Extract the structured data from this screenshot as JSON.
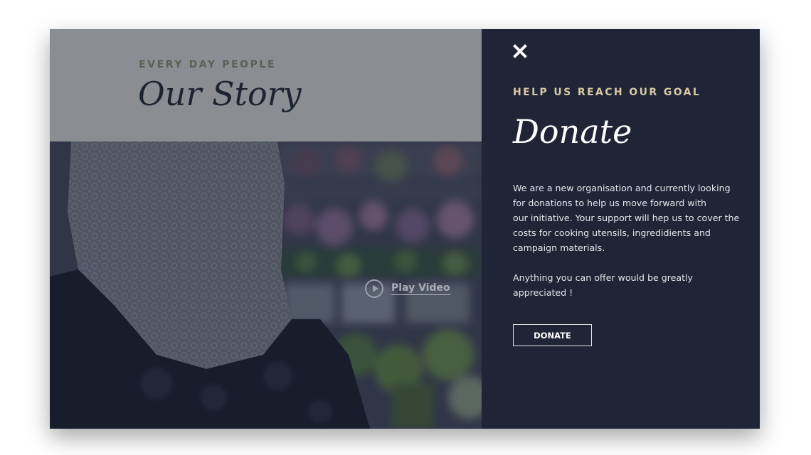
{
  "story": {
    "eyebrow": "EVERY DAY PEOPLE",
    "title": "Our Story",
    "play_label": "Play Video"
  },
  "donate_panel": {
    "eyebrow": "HELP US REACH OUR GOAL",
    "title": "Donate",
    "body_lines": [
      "We are a new organisation and currently looking",
      "for donations to help us move forward with",
      "our initiative. Your support will hep us to cover the",
      "costs for cooking utensils, ingredidients and",
      "campaign materials."
    ],
    "body_lines_2": [
      "Anything you can offer would be greatly",
      "appreciated !"
    ],
    "button_label": "DONATE",
    "close_icon": "close-icon"
  },
  "colors": {
    "left_header_bg": "#8a8e93",
    "right_panel_bg": "#1f2536",
    "accent_gold": "#d8c8a4",
    "dark_title": "#1c2331"
  }
}
